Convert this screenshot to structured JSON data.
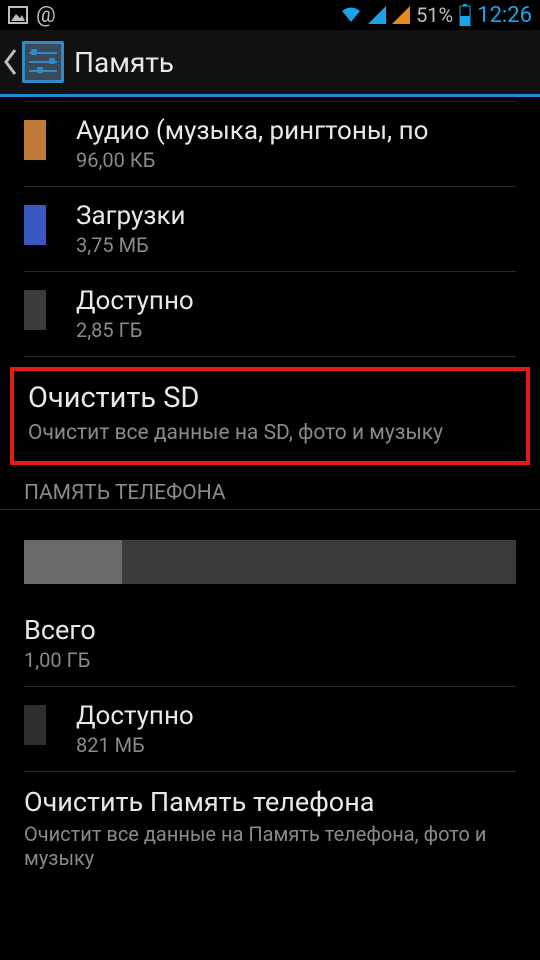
{
  "status": {
    "battery_text": "51%",
    "clock": "12:26"
  },
  "header": {
    "title": "Память"
  },
  "storage_items": [
    {
      "title": "Аудио (музыка, рингтоны, по",
      "sub": "96,00 КБ",
      "color": "#c27a3a"
    },
    {
      "title": "Загрузки",
      "sub": "3,75 МБ",
      "color": "#3a57c2"
    },
    {
      "title": "Доступно",
      "sub": "2,85 ГБ",
      "color": "#3b3b3b"
    }
  ],
  "clear_sd": {
    "title": "Очистить SD",
    "sub": "Очистит все данные на SD, фото и музыку"
  },
  "section_phone_memory": "ПАМЯТЬ ТЕЛЕФОНА",
  "phone_usage": {
    "used_percent": 20
  },
  "phone_total": {
    "title": "Всего",
    "sub": "1,00 ГБ"
  },
  "phone_available": {
    "title": "Доступно",
    "sub": "821 МБ",
    "color": "#2e2e2e"
  },
  "clear_phone": {
    "title": "Очистить Память телефона",
    "sub": "Очистит все данные на Память телефона, фото и музыку"
  }
}
